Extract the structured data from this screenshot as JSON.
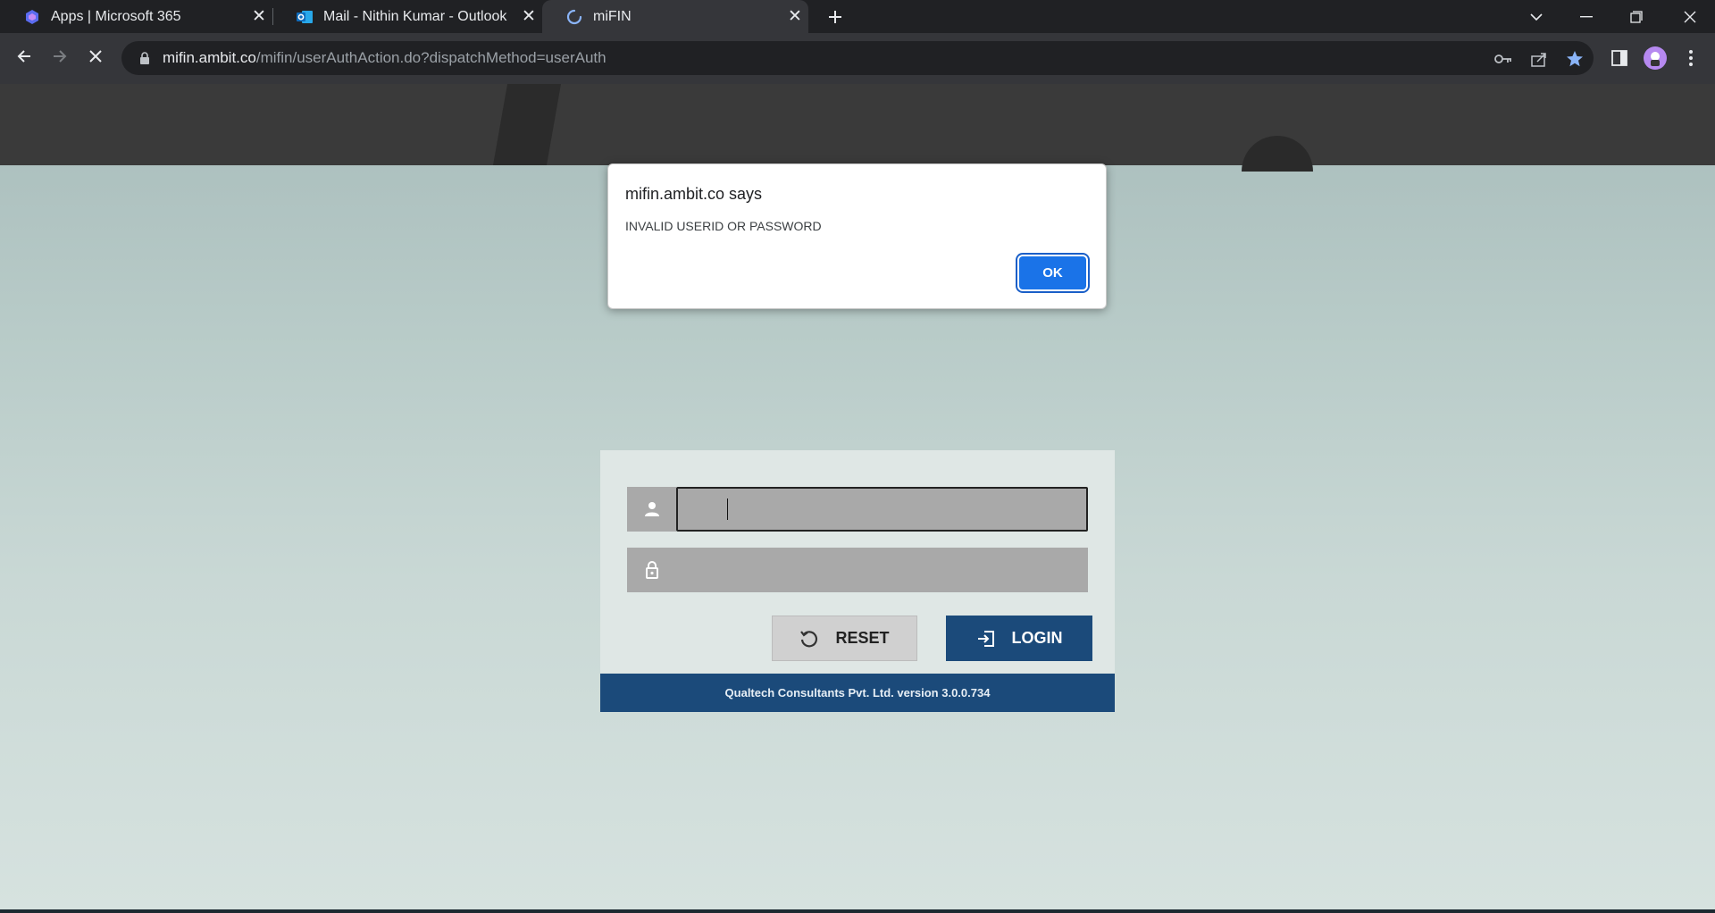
{
  "tabs": [
    {
      "label": "Apps | Microsoft 365",
      "icon": "microsoft365-icon"
    },
    {
      "label": "Mail - Nithin Kumar - Outlook",
      "icon": "outlook-icon"
    },
    {
      "label": "miFIN",
      "icon": "loading-spinner-icon",
      "active": true
    }
  ],
  "address_bar": {
    "host": "mifin.ambit.co",
    "path": "/mifin/userAuthAction.do?dispatchMethod=userAuth"
  },
  "alert": {
    "title": "mifin.ambit.co says",
    "message": "INVALID USERID OR PASSWORD",
    "ok_label": "OK"
  },
  "login": {
    "username_value": "",
    "password_value": "",
    "reset_label": "RESET",
    "login_label": "LOGIN",
    "footer": "Qualtech Consultants Pvt. Ltd. version 3.0.0.734"
  },
  "colors": {
    "browser_frame": "#202124",
    "toolbar": "#35363a",
    "brand_blue": "#1b4a7a",
    "dialog_button": "#1a73e8"
  }
}
